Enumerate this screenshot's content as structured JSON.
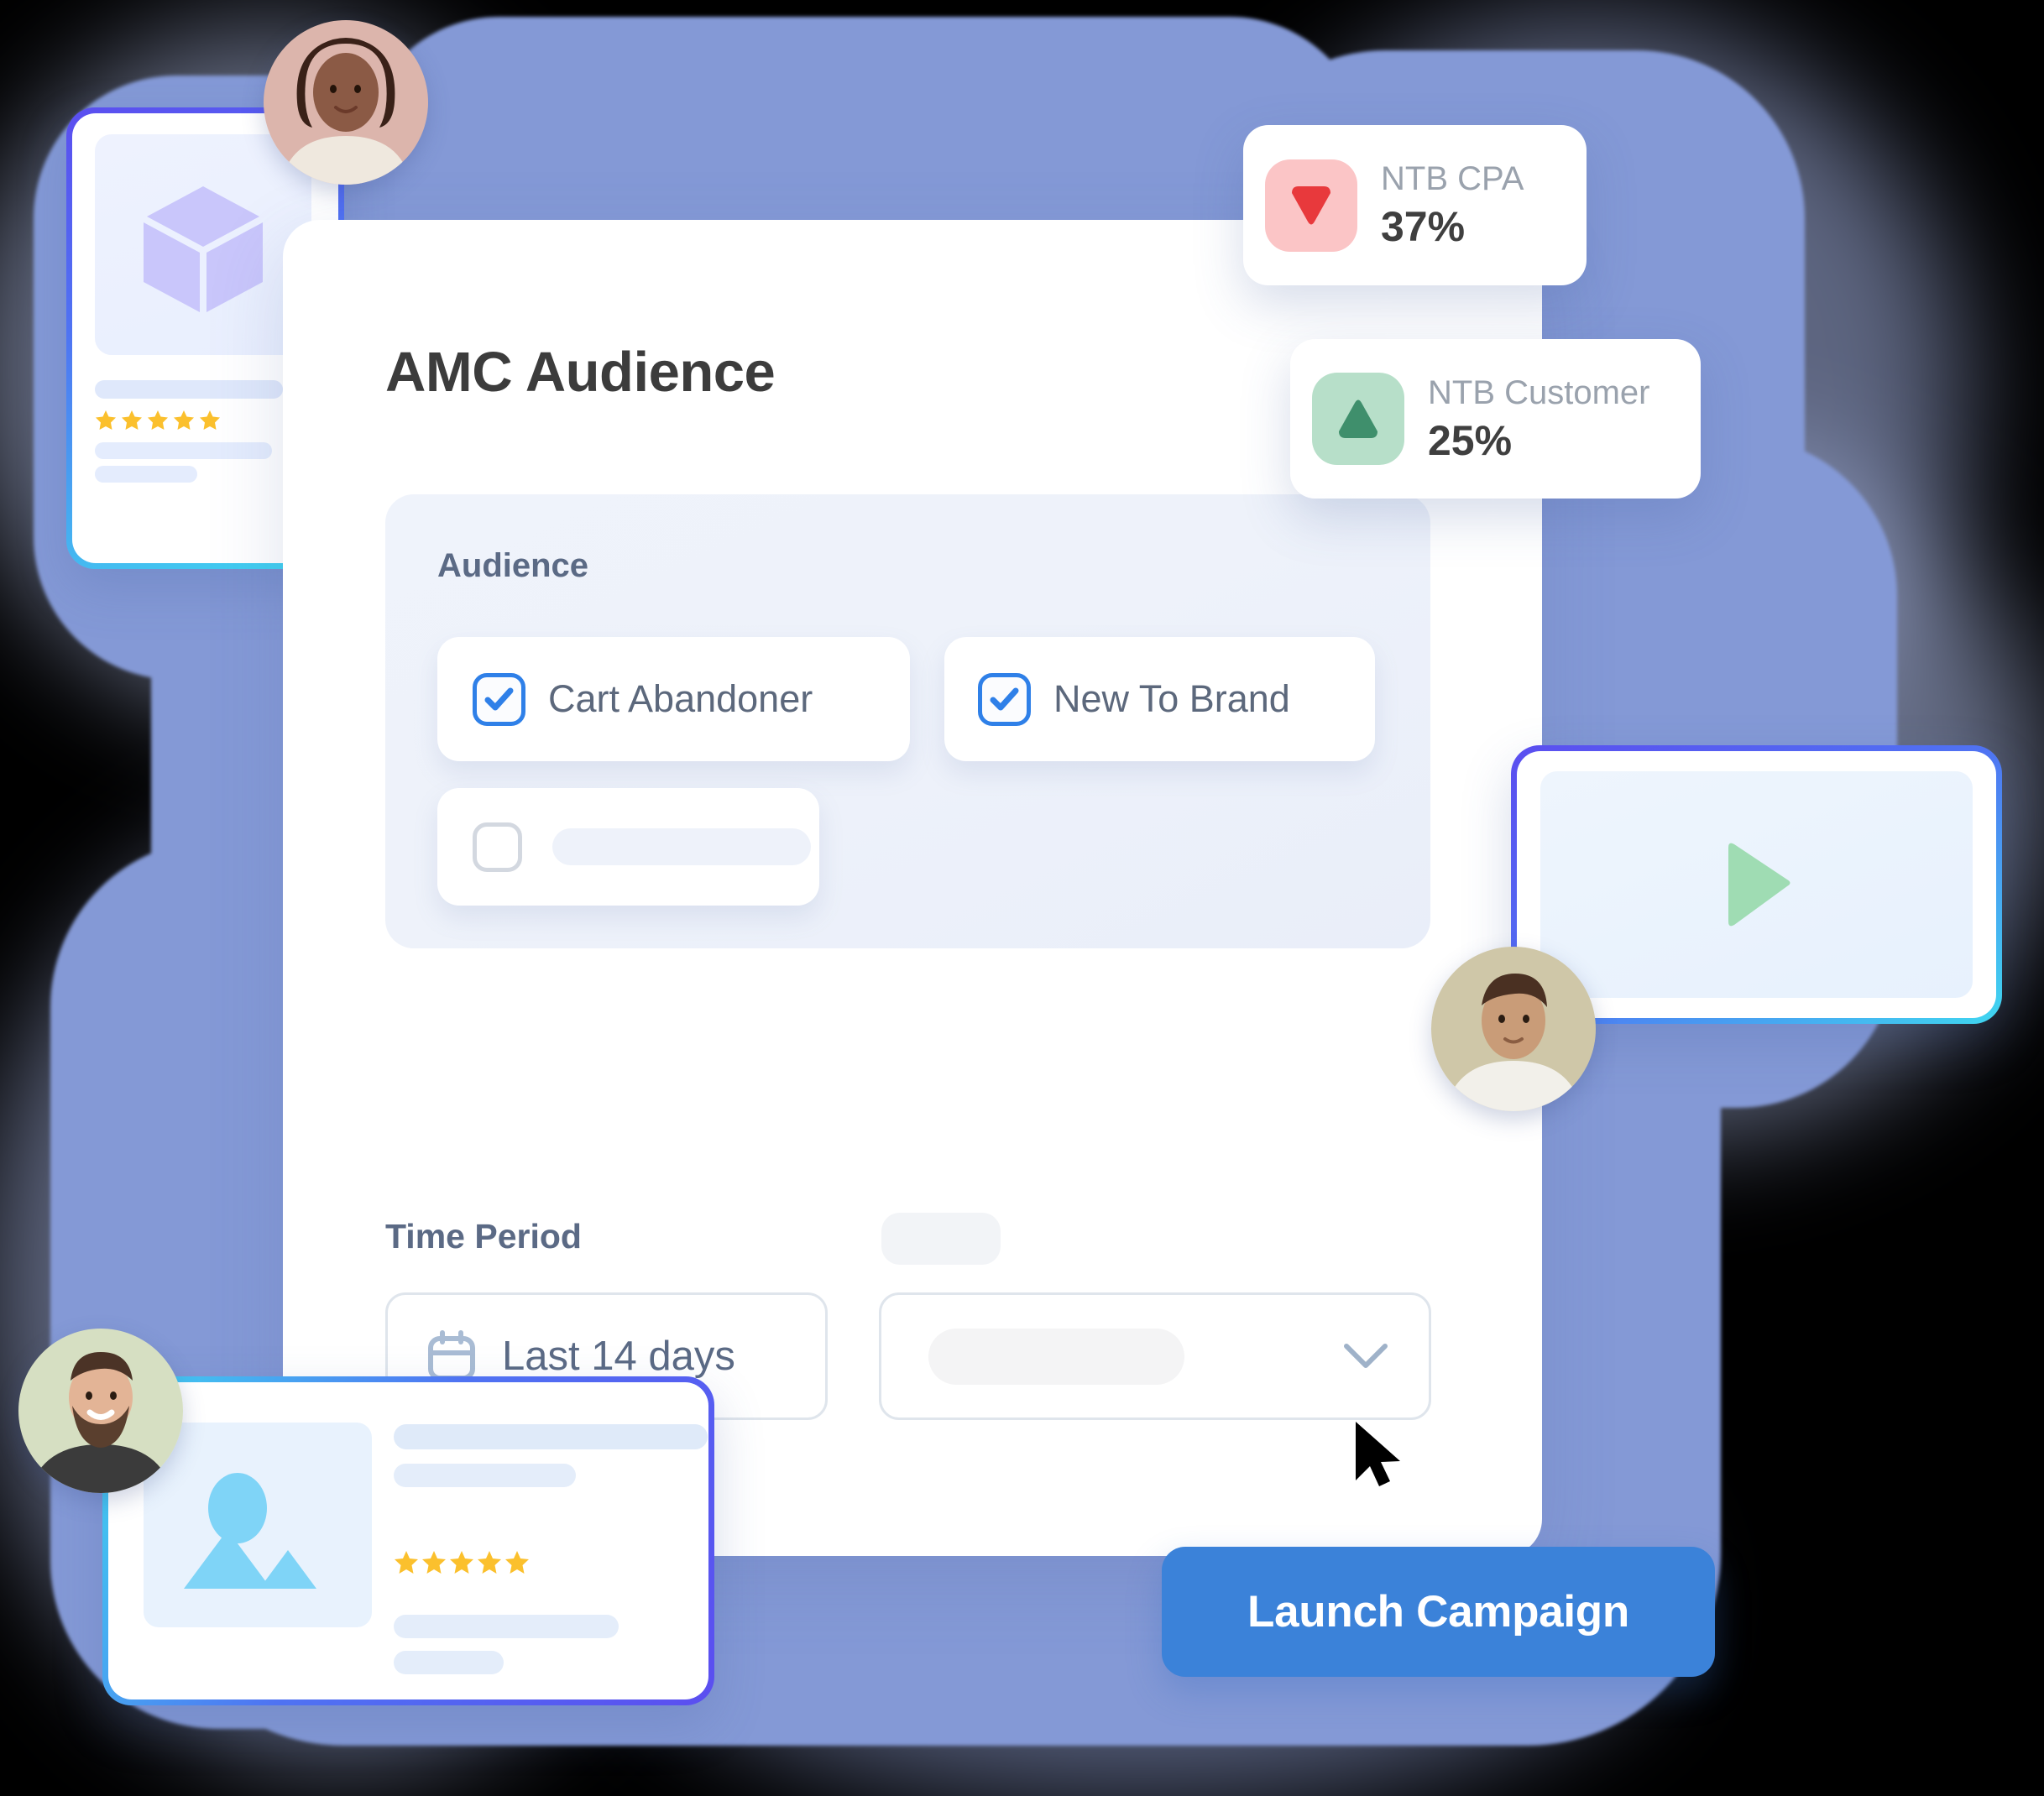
{
  "panel": {
    "title": "AMC Audience"
  },
  "audience_section": {
    "label": "Audience",
    "options": [
      {
        "label": "Cart Abandoner",
        "checked": true,
        "icon": "checkbox-checked-icon"
      },
      {
        "label": "New To Brand",
        "checked": true,
        "icon": "checkbox-checked-icon"
      },
      {
        "label": "",
        "checked": false,
        "icon": "checkbox-unchecked-icon"
      }
    ]
  },
  "time_period": {
    "label": "Time Period",
    "date_range": {
      "value": "Last 14 days",
      "icon": "calendar-icon"
    },
    "select": {
      "value": "",
      "icon": "chevron-down-icon"
    }
  },
  "actions": {
    "launch_label": "Launch Campaign"
  },
  "metrics": [
    {
      "name": "NTB CPA",
      "value": "37%",
      "direction": "down",
      "icon": "triangle-down-icon",
      "icon_bg": "#fbc5c6",
      "icon_fg": "#e8393c"
    },
    {
      "name": "NTB Customer",
      "value": "25%",
      "direction": "up",
      "icon": "triangle-up-icon",
      "icon_bg": "#b7dfc9",
      "icon_fg": "#3f8f6c"
    }
  ],
  "side_cards": {
    "product_card": {
      "icon": "cube-icon",
      "rating": 5
    },
    "review_card": {
      "icon": "image-icon",
      "rating": 5
    },
    "video_card": {
      "icon": "play-icon"
    }
  },
  "avatars": [
    {
      "name": "avatar-top-left"
    },
    {
      "name": "avatar-right"
    },
    {
      "name": "avatar-bottom-left"
    }
  ],
  "cursor": {
    "icon": "mouse-pointer-icon"
  },
  "colors": {
    "brand_blue": "#3b82d9",
    "checkbox_blue": "#2f80e8",
    "background_blob": "#8499d6",
    "text_primary": "#3c3c3c",
    "text_secondary": "#5b6a85",
    "star_gold": "#fbc02d",
    "card_border_gradient_start": "#5b4ef0",
    "card_border_gradient_end": "#3fd7f0",
    "play_green": "#9fdcb3"
  }
}
